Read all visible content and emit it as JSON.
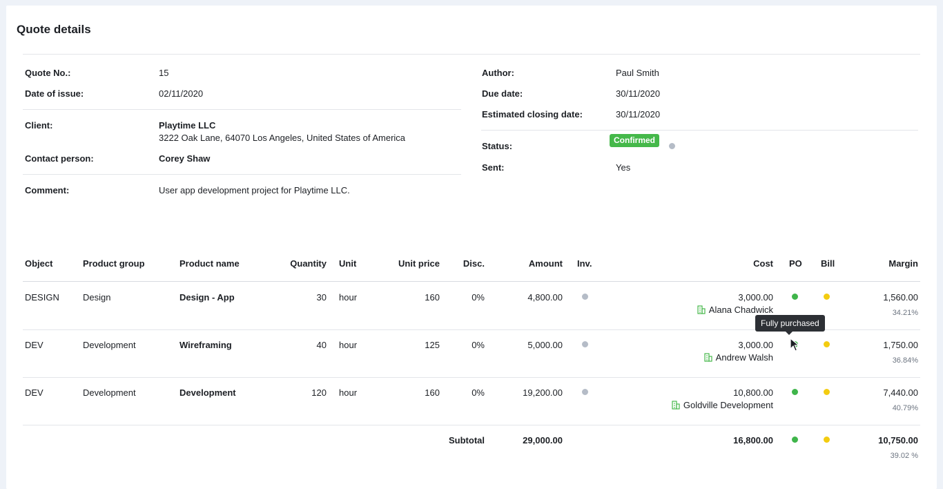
{
  "title": "Quote details",
  "info": {
    "quote_no_label": "Quote No.:",
    "quote_no": "15",
    "date_issue_label": "Date of issue:",
    "date_issue": "02/11/2020",
    "client_label": "Client:",
    "client_name": "Playtime LLC",
    "client_address": "3222 Oak Lane, 64070 Los Angeles, United States of America",
    "contact_label": "Contact person:",
    "contact": "Corey Shaw",
    "comment_label": "Comment:",
    "comment": "User app development project for Playtime LLC.",
    "author_label": "Author:",
    "author": "Paul Smith",
    "due_label": "Due date:",
    "due": "30/11/2020",
    "closing_label": "Estimated closing date:",
    "closing": "30/11/2020",
    "status_label": "Status:",
    "status": "Confirmed",
    "sent_label": "Sent:",
    "sent": "Yes"
  },
  "colors": {
    "confirmed": "#45b84a",
    "po_green": "#3fb54a",
    "bill_yellow": "#f3cc10",
    "inv_grey": "#b5bcc7"
  },
  "table": {
    "headers": {
      "object": "Object",
      "group": "Product group",
      "name": "Product name",
      "quantity": "Quantity",
      "unit": "Unit",
      "unit_price": "Unit price",
      "disc": "Disc.",
      "amount": "Amount",
      "inv": "Inv.",
      "cost": "Cost",
      "po": "PO",
      "bill": "Bill",
      "margin": "Margin"
    },
    "rows": [
      {
        "object": "DESIGN",
        "group": "Design",
        "name": "Design - App",
        "quantity": "30",
        "unit": "hour",
        "unit_price": "160",
        "disc": "0%",
        "amount": "4,800.00",
        "cost": "3,000.00",
        "supplier": "Alana Chadwick",
        "margin": "1,560.00",
        "margin_pct": "34.21%"
      },
      {
        "object": "DEV",
        "group": "Development",
        "name": "Wireframing",
        "quantity": "40",
        "unit": "hour",
        "unit_price": "125",
        "disc": "0%",
        "amount": "5,000.00",
        "cost": "3,000.00",
        "supplier": "Andrew Walsh",
        "margin": "1,750.00",
        "margin_pct": "36.84%"
      },
      {
        "object": "DEV",
        "group": "Development",
        "name": "Development",
        "quantity": "120",
        "unit": "hour",
        "unit_price": "160",
        "disc": "0%",
        "amount": "19,200.00",
        "cost": "10,800.00",
        "supplier": "Goldville Development",
        "margin": "7,440.00",
        "margin_pct": "40.79%"
      }
    ],
    "subtotal": {
      "label": "Subtotal",
      "amount": "29,000.00",
      "cost": "16,800.00",
      "margin": "10,750.00",
      "margin_pct": "39.02 %"
    }
  },
  "tooltip": "Fully purchased"
}
